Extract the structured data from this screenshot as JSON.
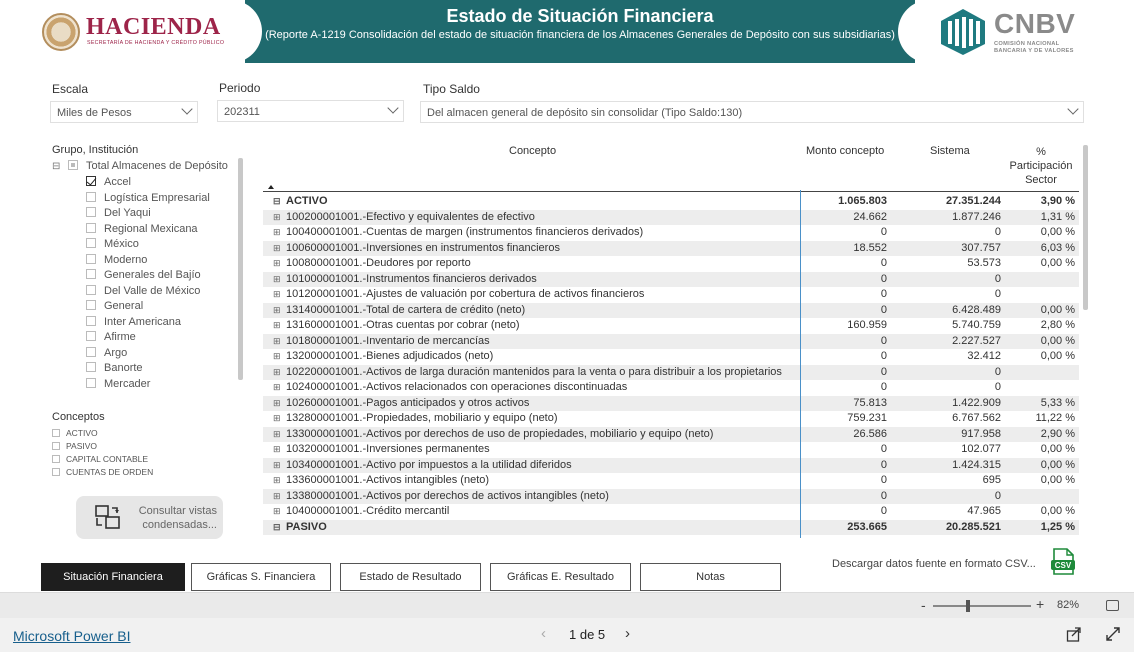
{
  "header": {
    "title": "Estado de Situación Financiera",
    "subtitle": "(Reporte A-1219 Consolidación del estado de situación financiera de los Almacenes Generales de Depósito con sus subsidiarias)",
    "band_color": "#1f6a6e",
    "hacienda": {
      "word": "HACIENDA",
      "sub": "SECRETARÍA DE HACIENDA Y CRÉDITO PÚBLICO",
      "color": "#9d2449"
    },
    "cnbv": {
      "word": "CNBV",
      "sub1": "COMISIÓN NACIONAL",
      "sub2": "BANCARIA Y DE VALORES",
      "color": "#1f7a80"
    }
  },
  "filters": {
    "escala": {
      "label": "Escala",
      "value": "Miles de Pesos"
    },
    "periodo": {
      "label": "Periodo",
      "value": "202311"
    },
    "tipo_saldo": {
      "label": "Tipo Saldo",
      "value": "Del almacen general de depósito sin consolidar (Tipo Saldo:130)"
    }
  },
  "slicer": {
    "title": "Grupo, Institución",
    "root": "Total Almacenes de Depósito",
    "items": [
      {
        "label": "Accel",
        "checked": true
      },
      {
        "label": "Logística Empresarial",
        "checked": false
      },
      {
        "label": "Del Yaqui",
        "checked": false
      },
      {
        "label": "Regional Mexicana",
        "checked": false
      },
      {
        "label": "México",
        "checked": false
      },
      {
        "label": "Moderno",
        "checked": false
      },
      {
        "label": "Generales del Bajío",
        "checked": false
      },
      {
        "label": "Del Valle de México",
        "checked": false
      },
      {
        "label": "General",
        "checked": false
      },
      {
        "label": "Inter Americana",
        "checked": false
      },
      {
        "label": "Afirme",
        "checked": false
      },
      {
        "label": "Argo",
        "checked": false
      },
      {
        "label": "Banorte",
        "checked": false
      },
      {
        "label": "Mercader",
        "checked": false
      }
    ]
  },
  "conceptos": {
    "title": "Conceptos",
    "items": [
      "ACTIVO",
      "PASIVO",
      "CAPITAL CONTABLE",
      "CUENTAS DE ORDEN"
    ]
  },
  "vistas_button": {
    "line1": "Consultar vistas",
    "line2": "condensadas..."
  },
  "table": {
    "headers": {
      "concepto": "Concepto",
      "monto": "Monto concepto",
      "sistema": "Sistema",
      "pct1": "%",
      "pct2": "Participación",
      "pct3": "Sector"
    },
    "rows": [
      {
        "toggle": "⊟",
        "concept": "ACTIVO",
        "monto": "1.065.803",
        "sistema": "27.351.244",
        "pct": "3,90 %",
        "bold": true
      },
      {
        "toggle": "⊞",
        "concept": "100200001001.-Efectivo y equivalentes de efectivo",
        "monto": "24.662",
        "sistema": "1.877.246",
        "pct": "1,31 %"
      },
      {
        "toggle": "⊞",
        "concept": "100400001001.-Cuentas de margen (instrumentos financieros derivados)",
        "monto": "0",
        "sistema": "0",
        "pct": "0,00 %"
      },
      {
        "toggle": "⊞",
        "concept": "100600001001.-Inversiones en instrumentos financieros",
        "monto": "18.552",
        "sistema": "307.757",
        "pct": "6,03 %"
      },
      {
        "toggle": "⊞",
        "concept": "100800001001.-Deudores por reporto",
        "monto": "0",
        "sistema": "53.573",
        "pct": "0,00 %"
      },
      {
        "toggle": "⊞",
        "concept": "101000001001.-Instrumentos financieros derivados",
        "monto": "0",
        "sistema": "0",
        "pct": ""
      },
      {
        "toggle": "⊞",
        "concept": "101200001001.-Ajustes de valuación por cobertura de activos financieros",
        "monto": "0",
        "sistema": "0",
        "pct": ""
      },
      {
        "toggle": "⊞",
        "concept": "131400001001.-Total de cartera de crédito (neto)",
        "monto": "0",
        "sistema": "6.428.489",
        "pct": "0,00 %"
      },
      {
        "toggle": "⊞",
        "concept": "131600001001.-Otras cuentas por cobrar (neto)",
        "monto": "160.959",
        "sistema": "5.740.759",
        "pct": "2,80 %"
      },
      {
        "toggle": "⊞",
        "concept": "101800001001.-Inventario de mercancías",
        "monto": "0",
        "sistema": "2.227.527",
        "pct": "0,00 %"
      },
      {
        "toggle": "⊞",
        "concept": "132000001001.-Bienes adjudicados (neto)",
        "monto": "0",
        "sistema": "32.412",
        "pct": "0,00 %"
      },
      {
        "toggle": "⊞",
        "concept": "102200001001.-Activos de larga duración mantenidos para la venta o para distribuir a los propietarios",
        "monto": "0",
        "sistema": "0",
        "pct": ""
      },
      {
        "toggle": "⊞",
        "concept": "102400001001.-Activos relacionados con operaciones discontinuadas",
        "monto": "0",
        "sistema": "0",
        "pct": ""
      },
      {
        "toggle": "⊞",
        "concept": "102600001001.-Pagos anticipados y otros activos",
        "monto": "75.813",
        "sistema": "1.422.909",
        "pct": "5,33 %"
      },
      {
        "toggle": "⊞",
        "concept": "132800001001.-Propiedades, mobiliario y equipo (neto)",
        "monto": "759.231",
        "sistema": "6.767.562",
        "pct": "11,22 %"
      },
      {
        "toggle": "⊞",
        "concept": "133000001001.-Activos por derechos de uso de propiedades, mobiliario y equipo (neto)",
        "monto": "26.586",
        "sistema": "917.958",
        "pct": "2,90 %"
      },
      {
        "toggle": "⊞",
        "concept": "103200001001.-Inversiones permanentes",
        "monto": "0",
        "sistema": "102.077",
        "pct": "0,00 %"
      },
      {
        "toggle": "⊞",
        "concept": "103400001001.-Activo por impuestos a la utilidad diferidos",
        "monto": "0",
        "sistema": "1.424.315",
        "pct": "0,00 %"
      },
      {
        "toggle": "⊞",
        "concept": "133600001001.-Activos intangibles (neto)",
        "monto": "0",
        "sistema": "695",
        "pct": "0,00 %"
      },
      {
        "toggle": "⊞",
        "concept": "133800001001.-Activos por derechos de activos intangibles (neto)",
        "monto": "0",
        "sistema": "0",
        "pct": ""
      },
      {
        "toggle": "⊞",
        "concept": "104000001001.-Crédito mercantil",
        "monto": "0",
        "sistema": "47.965",
        "pct": "0,00 %"
      },
      {
        "toggle": "⊟",
        "concept": "PASIVO",
        "monto": "253.665",
        "sistema": "20.285.521",
        "pct": "1,25 %",
        "bold": true
      }
    ]
  },
  "tabs": [
    "Situación Financiera",
    "Gráficas S. Financiera",
    "Estado de Resultado",
    "Gráficas E. Resultado",
    "Notas"
  ],
  "download_text": "Descargar datos fuente en formato CSV...",
  "csv_label": "CSV",
  "zoom": {
    "minus": "-",
    "plus": "+",
    "value": "82%",
    "level": 0.82
  },
  "footer": {
    "brand": "Microsoft Power BI",
    "page": "1 de 5"
  }
}
